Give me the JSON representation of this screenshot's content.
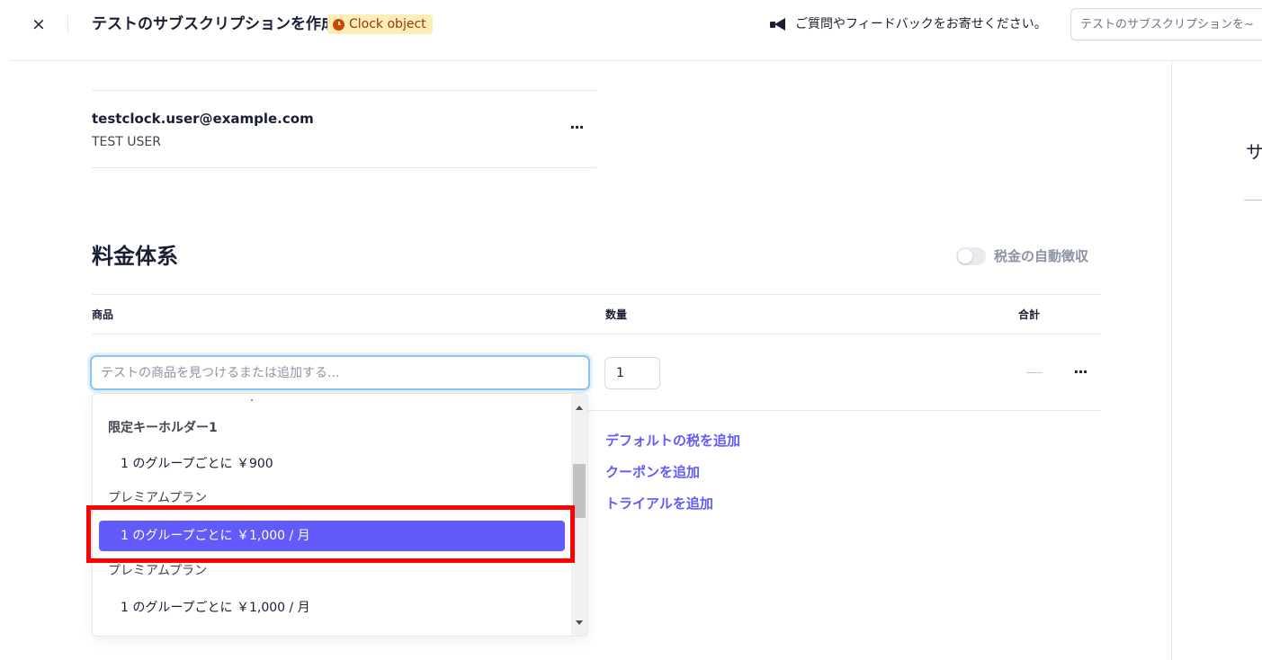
{
  "header": {
    "close_icon": "×",
    "title": "テストのサブスクリプションを作成",
    "badge": "Clock object",
    "feedback": "ご質問やフィードバックをお寄せください。",
    "search_placeholder": "テストのサブスクリプションを~"
  },
  "right_panel": {
    "heading_fragment": "サ"
  },
  "customer": {
    "email": "testclock.user@example.com",
    "name": "TEST USER",
    "more": "···"
  },
  "pricing": {
    "title": "料金体系",
    "auto_tax_label": "税金の自動徴収",
    "auto_tax_enabled": false,
    "columns": {
      "product": "商品",
      "quantity": "数量",
      "total": "合計"
    },
    "product_placeholder": "テストの商品を見つけるまたは追加する...",
    "quantity_value": "1",
    "row_more": "···",
    "actions": {
      "add_default_tax": "デフォルトの税を追加",
      "add_coupon": "クーポンを追加",
      "add_trial": "トライアルを追加"
    }
  },
  "dropdown": {
    "group_1": "限定キーホルダー1",
    "option_1": "1 のグループごとに ￥900",
    "group_2": "プレミアムプラン",
    "option_2_selected": "1 のグループごとに ￥1,000 / 月",
    "group_3": "プレミアムプラン",
    "option_3": "1 のグループごとに ￥1,000 / 月"
  },
  "colors": {
    "accent": "#625afa",
    "highlight": "#ff0000",
    "badge_bg": "#fcedb9",
    "badge_text": "#983705"
  },
  "icons": {
    "close": "close-icon",
    "clock": "clock-icon",
    "megaphone": "megaphone-icon",
    "more": "ellipsis-icon",
    "scroll_up": "chevron-up-icon",
    "scroll_down": "chevron-down-icon"
  }
}
